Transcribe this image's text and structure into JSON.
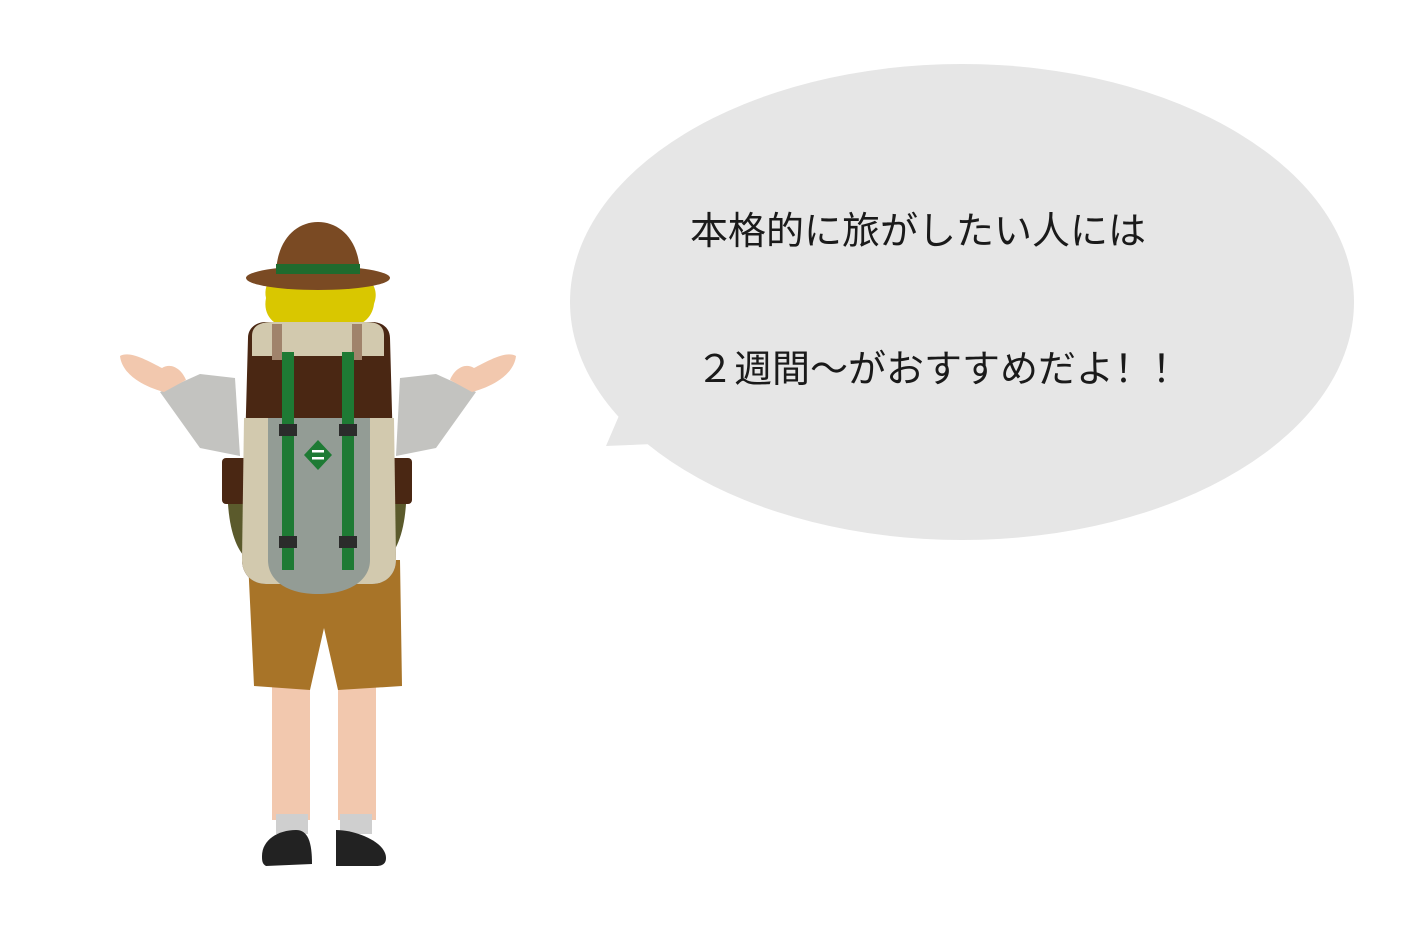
{
  "speech_bubble": {
    "lines": [
      "本格的に旅がしたい人には",
      "２週間〜がおすすめだよ！！"
    ]
  },
  "illustration": {
    "subject": "backpacker-shrugging",
    "icons": [
      "hat-icon",
      "backpack-icon",
      "diamond-emblem-icon"
    ]
  },
  "colors": {
    "bubble": "#e6e6e6",
    "hat": "#7a4a23",
    "hat_band": "#1f6b2e",
    "hair": "#d9c700",
    "pack_dark": "#4a2713",
    "pack_light": "#d2c9ae",
    "pack_gray": "#939c95",
    "strap_green": "#1e7a34",
    "sleeve": "#c3c3c0",
    "skin": "#f2c8ae",
    "shorts": "#a87428",
    "shoe": "#222222"
  }
}
